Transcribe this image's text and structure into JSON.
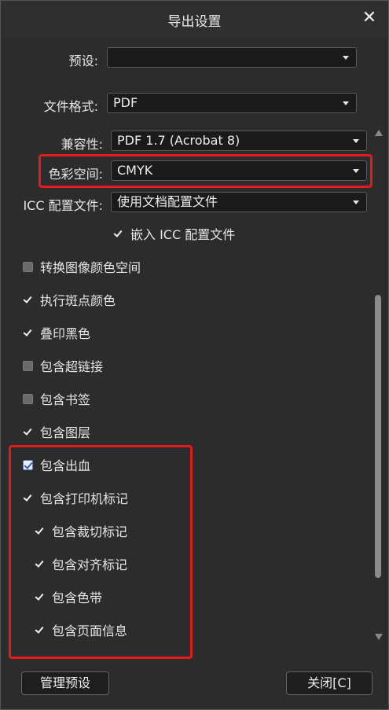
{
  "window": {
    "title": "导出设置"
  },
  "preset": {
    "label": "预设:",
    "value": ""
  },
  "format": {
    "label": "文件格式:",
    "value": "PDF"
  },
  "compat": {
    "label": "兼容性:",
    "value": "PDF 1.7 (Acrobat 8)"
  },
  "colorspace": {
    "label": "色彩空间:",
    "value": "CMYK"
  },
  "icc": {
    "label": "ICC 配置文件:",
    "value": "使用文档配置文件"
  },
  "checkboxes": [
    {
      "label": "嵌入 ICC 配置文件",
      "checked": true
    },
    {
      "label": "转换图像颜色空间",
      "checked": false
    },
    {
      "label": "执行斑点颜色",
      "checked": true
    },
    {
      "label": "叠印黑色",
      "checked": true
    },
    {
      "label": "包含超链接",
      "checked": false
    },
    {
      "label": "包含书签",
      "checked": false
    },
    {
      "label": "包含图层",
      "checked": true
    },
    {
      "label": "包含出血",
      "checked": true
    },
    {
      "label": "包含打印机标记",
      "checked": true
    },
    {
      "label": "包含裁切标记",
      "checked": true
    },
    {
      "label": "包含对齐标记",
      "checked": true
    },
    {
      "label": "包含色带",
      "checked": true
    },
    {
      "label": "包含页面信息",
      "checked": true
    }
  ],
  "footer": {
    "manage_label": "管理预设",
    "close_label": "关闭[C]"
  },
  "colors": {
    "highlight": "#e21b1b",
    "panel": "#2c2c2c",
    "field": "#1a1a1a"
  },
  "icons": {
    "close": "close-icon",
    "caret": "chevron-down-icon",
    "check": "checkmark-icon"
  }
}
